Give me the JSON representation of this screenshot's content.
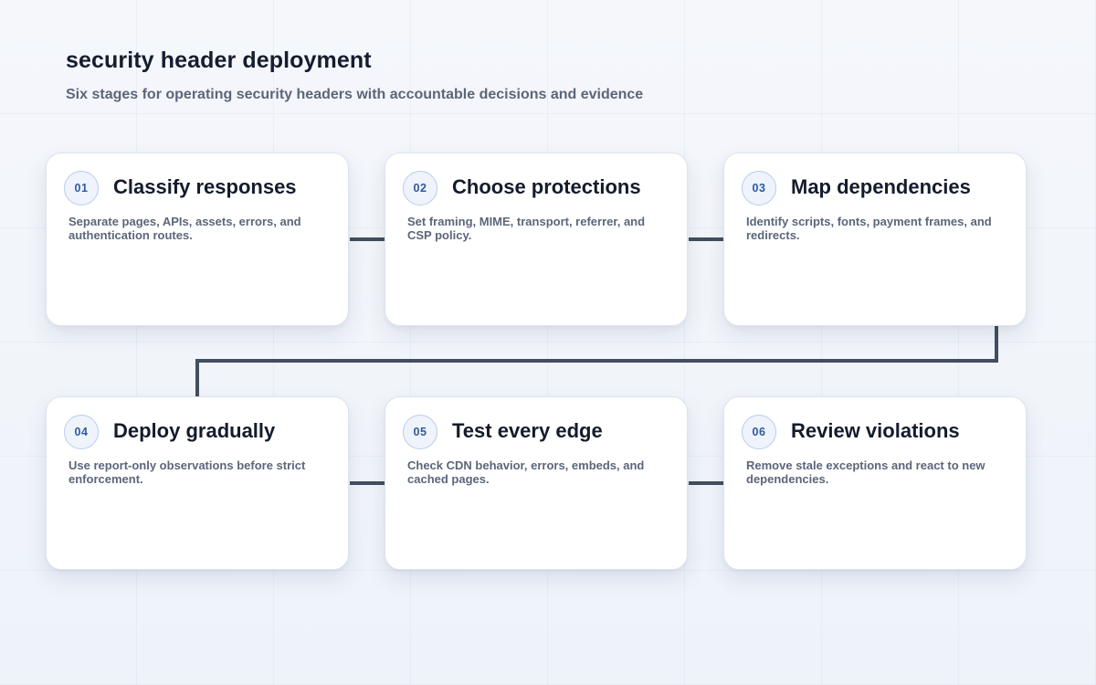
{
  "header": {
    "title": "security header deployment",
    "subtitle": "Six stages for operating security headers with accountable decisions and evidence"
  },
  "stages": [
    {
      "number": "01",
      "title": "Classify responses",
      "description": "Separate pages, APIs, assets, errors, and authentication routes."
    },
    {
      "number": "02",
      "title": "Choose protections",
      "description": "Set framing, MIME, transport, referrer, and CSP policy."
    },
    {
      "number": "03",
      "title": "Map dependencies",
      "description": "Identify scripts, fonts, payment frames, and redirects."
    },
    {
      "number": "04",
      "title": "Deploy gradually",
      "description": "Use report-only observations before strict enforcement."
    },
    {
      "number": "05",
      "title": "Test every edge",
      "description": "Check CDN behavior, errors, embeds, and cached pages."
    },
    {
      "number": "06",
      "title": "Review violations",
      "description": "Remove stale exceptions and react to new dependencies."
    }
  ],
  "colors": {
    "connector": "#434e60",
    "badge_text": "#2e5a9c",
    "title_text": "#151d2e",
    "muted_text": "#5c6678"
  }
}
